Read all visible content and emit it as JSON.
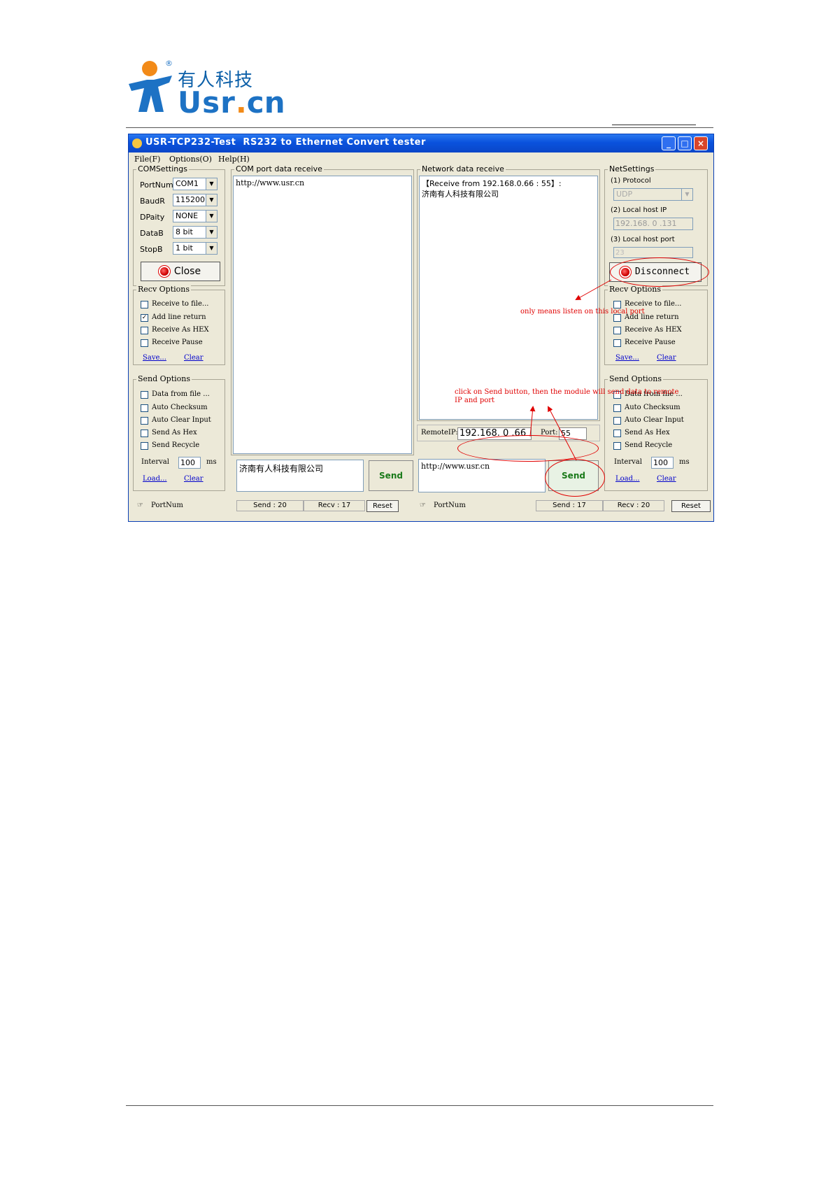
{
  "header": {
    "logo_cn": "有人科技",
    "logo_usr": "Usr",
    "logo_dot": ".",
    "logo_cn_domain": "cn",
    "registered": "®"
  },
  "window": {
    "title": "USR-TCP232-Test  RS232 to Ethernet Convert tester",
    "min_glyph": "_",
    "max_glyph": "□",
    "close_glyph": "×"
  },
  "menu": {
    "file": "File(F)",
    "options": "Options(O)",
    "help": "Help(H)"
  },
  "com_settings": {
    "group": "COMSettings",
    "portnum_label": "PortNum",
    "portnum_value": "COM1",
    "baudr_label": "BaudR",
    "baudr_value": "115200",
    "dpaity_label": "DPaity",
    "dpaity_value": "NONE",
    "datab_label": "DataB",
    "datab_value": "8 bit",
    "stopb_label": "StopB",
    "stopb_value": "1 bit",
    "close_label": "Close"
  },
  "left_recv": {
    "group": "Recv Options",
    "opt1": "Receive to file...",
    "opt2": "Add line return",
    "opt3": "Receive As HEX",
    "opt4": "Receive Pause",
    "check1": "",
    "check2": "✓",
    "check3": "",
    "check4": "",
    "save": "Save...",
    "clear": "Clear"
  },
  "left_send": {
    "group": "Send Options",
    "opt1": "Data from file ...",
    "opt2": "Auto Checksum",
    "opt3": "Auto Clear Input",
    "opt4": "Send As Hex",
    "opt5": "Send Recycle",
    "interval_label": "Interval",
    "interval_value": "100",
    "ms": "ms",
    "load": "Load...",
    "clear": "Clear"
  },
  "com_receive": {
    "group": "COM port data receive",
    "content": "http://www.usr.cn"
  },
  "com_send": {
    "input": "济南有人科技有限公司",
    "send": "Send"
  },
  "net_receive": {
    "group": "Network data receive",
    "content": "【Receive from 192.168.0.66 : 55】:\n济南有人科技有限公司"
  },
  "remote": {
    "ip_label": "RemoteIP:",
    "ip_value": "192.168. 0 .66",
    "port_label": "Port:",
    "port_value": "55"
  },
  "net_send": {
    "input": "http://www.usr.cn",
    "send": "Send"
  },
  "net_settings": {
    "group": "NetSettings",
    "protocol_label": "(1) Protocol",
    "protocol_value": "UDP",
    "local_ip_label": "(2) Local host IP",
    "local_ip_value": "192.168. 0 .131",
    "local_port_label": "(3) Local host port",
    "local_port_value": "23",
    "disconnect": "Disconnect"
  },
  "right_recv": {
    "group": "Recv Options",
    "opt1": "Receive to file...",
    "opt2": "Add line return",
    "opt3": "Receive As HEX",
    "opt4": "Receive Pause",
    "save": "Save...",
    "clear": "Clear"
  },
  "right_send": {
    "group": "Send Options",
    "opt1": "Data from file ...",
    "opt2": "Auto Checksum",
    "opt3": "Auto Clear Input",
    "opt4": "Send As Hex",
    "opt5": "Send Recycle",
    "interval_label": "Interval",
    "interval_value": "100",
    "ms": "ms",
    "load": "Load...",
    "clear": "Clear"
  },
  "status_left": {
    "portnum": "PortNum",
    "send": "Send : 20",
    "recv": "Recv : 17",
    "reset": "Reset"
  },
  "status_right": {
    "portnum": "PortNum",
    "send": "Send : 17",
    "recv": "Recv : 20",
    "reset": "Reset"
  },
  "annotations": {
    "listen": "only means listen on this local port",
    "send_line1": "click on Send button, then the module will send data to remote",
    "send_line2": "IP and port"
  },
  "colors": {
    "annotation": "#e00000",
    "title_bar": "#0a52dd",
    "send_text": "#1a7a1a"
  }
}
